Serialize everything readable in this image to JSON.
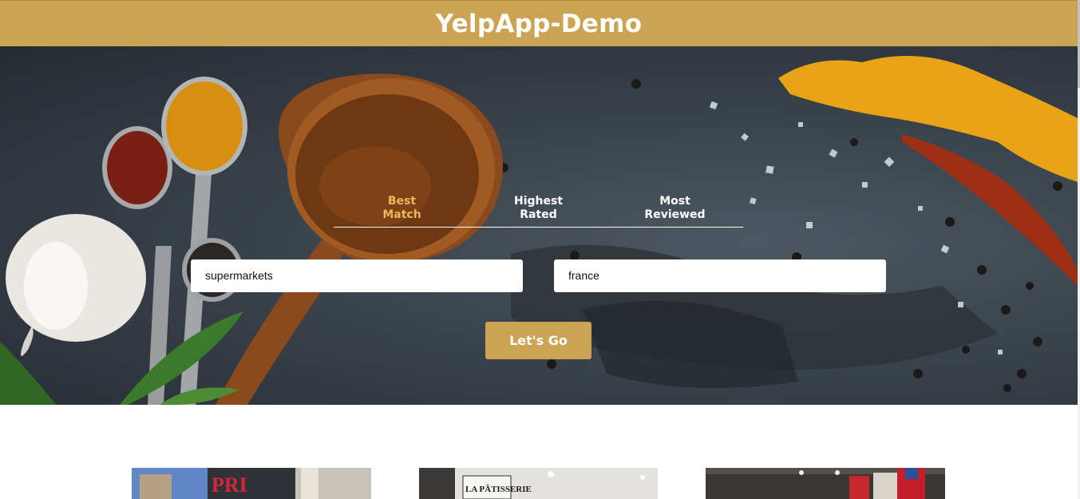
{
  "header": {
    "title": "YelpApp-Demo"
  },
  "search": {
    "sort_options": [
      {
        "label_line1": "Best",
        "label_line2": "Match",
        "active": true
      },
      {
        "label_line1": "Highest",
        "label_line2": "Rated",
        "active": false
      },
      {
        "label_line1": "Most",
        "label_line2": "Reviewed",
        "active": false
      }
    ],
    "term_value": "supermarkets",
    "location_value": "france",
    "submit_label": "Let's Go"
  },
  "business_cards": [
    {
      "image_sign_text": "PRI"
    },
    {
      "image_sign_text": "LA PÂTISSERIE"
    },
    {
      "image_sign_text": ""
    }
  ],
  "colors": {
    "brand": "#cca353",
    "active_tab": "#e8b956"
  }
}
